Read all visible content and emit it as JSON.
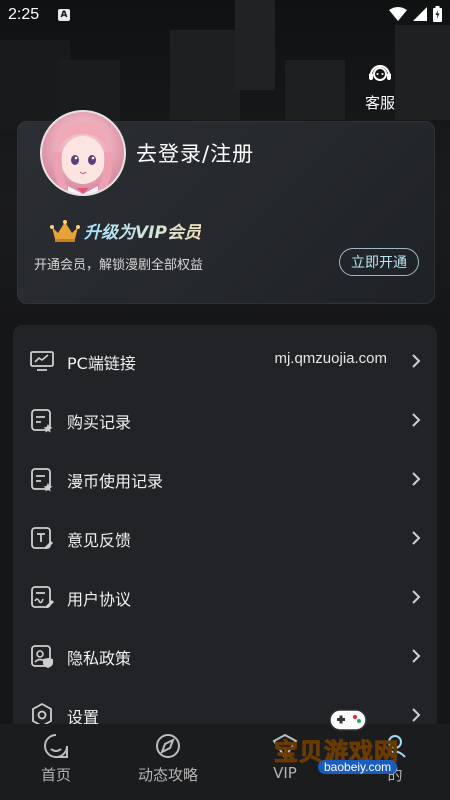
{
  "status_bar": {
    "time": "2:25",
    "notif_letter": "A"
  },
  "service": {
    "label": "客服"
  },
  "profile": {
    "login_text": "去登录/注册",
    "vip_title": "升级为VIP会员",
    "vip_desc": "开通会员，解锁漫剧全部权益",
    "vip_button": "立即开通"
  },
  "menu": {
    "items": [
      {
        "label": "PC端链接",
        "value": "mj.qmzuojia.com",
        "icon": "monitor-icon"
      },
      {
        "label": "购买记录",
        "icon": "record-icon"
      },
      {
        "label": "漫币使用记录",
        "icon": "coin-record-icon"
      },
      {
        "label": "意见反馈",
        "icon": "feedback-icon"
      },
      {
        "label": "用户协议",
        "icon": "agreement-icon"
      },
      {
        "label": "隐私政策",
        "icon": "privacy-icon"
      },
      {
        "label": "设置",
        "icon": "settings-icon"
      }
    ]
  },
  "tabbar": {
    "tabs": [
      {
        "label": "首页",
        "icon": "home-icon"
      },
      {
        "label": "动态攻略",
        "icon": "compass-icon"
      },
      {
        "label": "VIP",
        "icon": "vip-icon"
      },
      {
        "label": "的",
        "icon": "mine-icon"
      }
    ]
  },
  "watermark": {
    "text": "宝贝游戏网",
    "url": "baobeiy.com"
  },
  "colors": {
    "background": "#151617",
    "card": "#222326",
    "accent": "#b9e6f3",
    "gold": "#e8a33a"
  }
}
